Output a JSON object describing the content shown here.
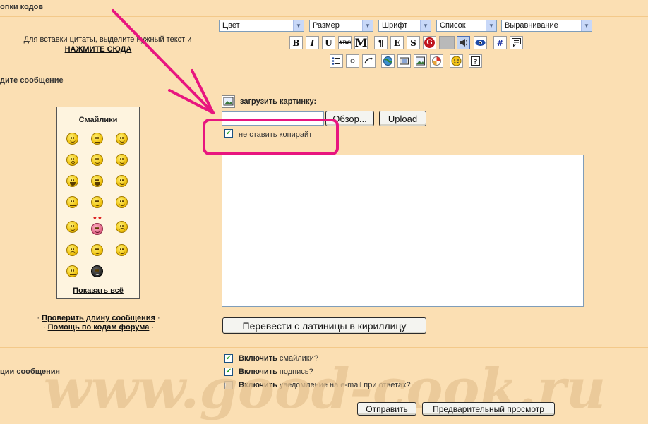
{
  "sections": {
    "codes_title": "опки кодов",
    "quote_hint": "Для вставки цитаты, выделите нужный текст и",
    "quote_link": "НАЖМИТЕ СЮДА",
    "message_title": "дите сообщение",
    "options_title": "ции сообщения"
  },
  "formatting": {
    "selects": [
      "Цвет",
      "Размер",
      "Шрифт",
      "Список",
      "Выравнивание"
    ],
    "row1_buttons": [
      {
        "label": "B",
        "icon": "bold-icon"
      },
      {
        "label": "I",
        "icon": "italic-icon"
      },
      {
        "label": "U",
        "icon": "underline-icon"
      },
      {
        "label": "ABC",
        "icon": "strikethrough-icon"
      },
      {
        "label": "M",
        "icon": "marquee-icon"
      },
      {
        "label": "¶",
        "icon": "paragraph-icon"
      },
      {
        "label": "E",
        "icon": "font-face-icon"
      },
      {
        "label": "S",
        "icon": "shadow-icon"
      },
      {
        "label": "G",
        "icon": "glow-icon"
      },
      {
        "label": "",
        "icon": "blank-icon"
      },
      {
        "label": "",
        "icon": "audio-icon"
      },
      {
        "label": "",
        "icon": "spoiler-eye-icon"
      },
      {
        "label": "#",
        "icon": "hash-icon"
      },
      {
        "label": "",
        "icon": "quote-bubble-icon"
      }
    ],
    "row2_buttons": [
      {
        "icon": "list-icon"
      },
      {
        "icon": "bullet-icon"
      },
      {
        "icon": "hyperlink-icon"
      },
      {
        "icon": "globe-link-icon"
      },
      {
        "icon": "flash-embed-icon"
      },
      {
        "icon": "image-icon"
      },
      {
        "icon": "wheel-icon"
      },
      {
        "icon": "smiley-icon"
      },
      {
        "icon": "help-icon"
      }
    ]
  },
  "smileys": {
    "title": "Смайлики",
    "show_all": "Показать всё",
    "check_length": "Проверить длину сообщения",
    "help_codes": "Помощь по кодам форума"
  },
  "upload": {
    "label": "загрузить картинку:",
    "file_value": "",
    "browse_button": "Обзор...",
    "upload_button": "Upload",
    "no_copyright_label": "не ставить копирайт",
    "no_copyright_checked": true
  },
  "message": {
    "text": "",
    "translit_button": "Перевести с латиницы в кириллицу"
  },
  "options": [
    {
      "bold": "Включить",
      "rest": " смайлики?",
      "checked": true
    },
    {
      "bold": "Включить",
      "rest": " подпись?",
      "checked": true
    },
    {
      "bold": "Включить",
      "rest": " уведомление на e-mail при ответах?",
      "checked": false
    }
  ],
  "actions": {
    "submit": "Отправить",
    "preview": "Предварительный просмотр"
  },
  "watermark": "www.good-cook.ru",
  "colors": {
    "background": "#fbdfb3",
    "annotation": "#e8157f"
  }
}
